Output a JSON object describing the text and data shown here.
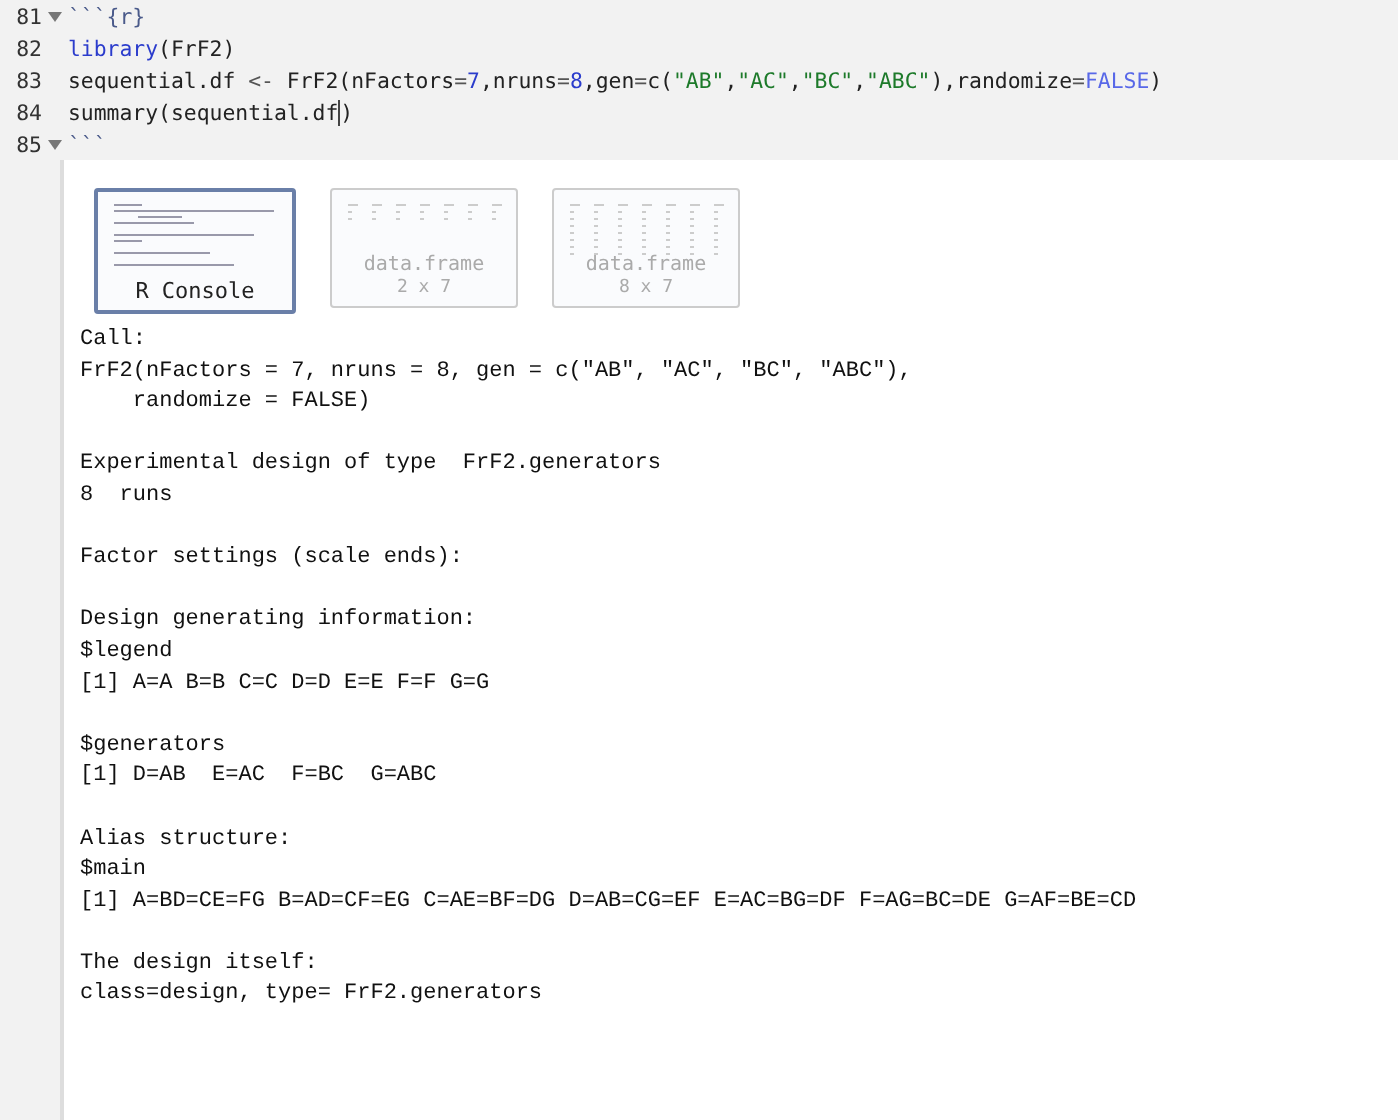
{
  "editor": {
    "lines": [
      {
        "number": "81",
        "foldable": true,
        "tokens": [
          {
            "kind": "fence",
            "text": "```{r}"
          }
        ]
      },
      {
        "number": "82",
        "foldable": false,
        "tokens": [
          {
            "kind": "function",
            "text": "library"
          },
          {
            "kind": "plain",
            "text": "(FrF2)"
          }
        ]
      },
      {
        "number": "83",
        "foldable": false,
        "tokens": [
          {
            "kind": "plain",
            "text": "sequential.df "
          },
          {
            "kind": "operator",
            "text": "<-"
          },
          {
            "kind": "plain",
            "text": " FrF2(nFactors"
          },
          {
            "kind": "operator",
            "text": "="
          },
          {
            "kind": "number",
            "text": "7"
          },
          {
            "kind": "plain",
            "text": ",nruns"
          },
          {
            "kind": "operator",
            "text": "="
          },
          {
            "kind": "number",
            "text": "8"
          },
          {
            "kind": "plain",
            "text": ",gen"
          },
          {
            "kind": "operator",
            "text": "="
          },
          {
            "kind": "plain",
            "text": "c("
          },
          {
            "kind": "string",
            "text": "\"AB\""
          },
          {
            "kind": "plain",
            "text": ","
          },
          {
            "kind": "string",
            "text": "\"AC\""
          },
          {
            "kind": "plain",
            "text": ","
          },
          {
            "kind": "string",
            "text": "\"BC\""
          },
          {
            "kind": "plain",
            "text": ","
          },
          {
            "kind": "string",
            "text": "\"ABC\""
          },
          {
            "kind": "plain",
            "text": "),randomize"
          },
          {
            "kind": "operator",
            "text": "="
          },
          {
            "kind": "constant",
            "text": "FALSE"
          },
          {
            "kind": "plain",
            "text": ")"
          }
        ]
      },
      {
        "number": "84",
        "foldable": false,
        "tokens": [
          {
            "kind": "plain",
            "text": "summary(sequential.df"
          },
          {
            "kind": "cursor"
          },
          {
            "kind": "plain",
            "text": ")"
          }
        ]
      },
      {
        "number": "85",
        "foldable": true,
        "tokens": [
          {
            "kind": "fence",
            "text": "```"
          }
        ]
      }
    ]
  },
  "output": {
    "tabs": [
      {
        "kind": "console",
        "label": "R Console",
        "selected": true
      },
      {
        "kind": "table",
        "label": "data.frame",
        "size": "2 x 7",
        "selected": false
      },
      {
        "kind": "table",
        "label": "data.frame",
        "size": "8 x 7",
        "selected": false
      }
    ],
    "sections": [
      {
        "blocks": [
          {
            "lines": [
              "Call:",
              "FrF2(nFactors = 7, nruns = 8, gen = c(\"AB\", \"AC\", \"BC\", \"ABC\"),",
              "    randomize = FALSE)"
            ]
          },
          {
            "lines": [
              "Experimental design of type  FrF2.generators",
              "8  runs"
            ]
          },
          {
            "lines": [
              "Factor settings (scale ends):"
            ]
          },
          {
            "lines": [
              "Design generating information:",
              "$legend",
              "[1] A=A B=B C=C D=D E=E F=F G=G"
            ]
          },
          {
            "lines": [
              "$generators",
              "[1] D=AB  E=AC  F=BC  G=ABC"
            ]
          }
        ]
      },
      {
        "blocks": [
          {
            "lines": [
              "Alias structure:",
              "$main",
              "[1] A=BD=CE=FG B=AD=CF=EG C=AE=BF=DG D=AB=CG=EF E=AC=BG=DF F=AG=BC=DE G=AF=BE=CD"
            ]
          }
        ]
      },
      {
        "blocks": [
          {
            "lines": [
              "The design itself:",
              "class=design, type= FrF2.generators"
            ]
          }
        ]
      }
    ]
  }
}
